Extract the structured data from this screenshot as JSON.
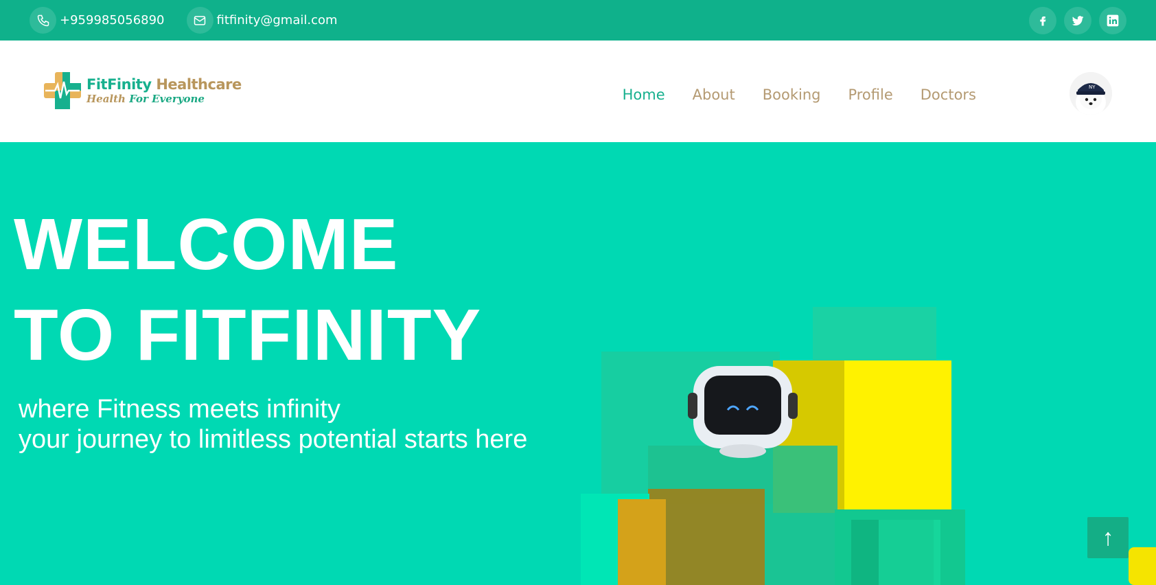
{
  "topbar": {
    "phone": "+959985056890",
    "email": "fitfinity@gmail.com",
    "socials": [
      "facebook-icon",
      "twitter-icon",
      "linkedin-icon"
    ]
  },
  "logo": {
    "brand_part1": "FitFinity",
    "brand_part2": "Healthcare",
    "tagline_part1": "Health",
    "tagline_part2": "For Everyone"
  },
  "nav": {
    "items": [
      "Home",
      "About",
      "Booking",
      "Profile",
      "Doctors"
    ],
    "active": "Home"
  },
  "hero": {
    "title_line1": "WELCOME",
    "title_line2": "TO FITFINITY",
    "subtitle_line1": "where Fitness meets infinity",
    "subtitle_line2": "your journey to limitless potential starts here"
  },
  "scroll_top_icon": "arrow-up-icon",
  "colors": {
    "topbar": "#0fb18b",
    "hero": "#00d9b3",
    "accent": "#17b08e",
    "nav_text": "#b49a72"
  }
}
